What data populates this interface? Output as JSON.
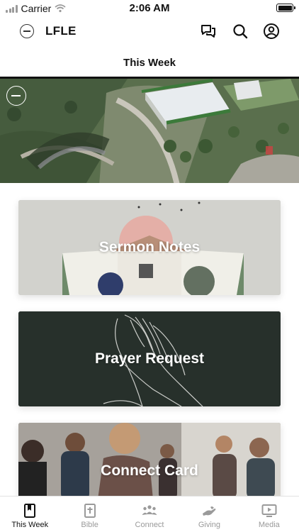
{
  "status_bar": {
    "carrier": "Carrier",
    "time": "2:06 AM"
  },
  "header": {
    "app_name": "LFLE"
  },
  "page_title": "This Week",
  "cards": {
    "sermon": {
      "label": "Sermon Notes"
    },
    "prayer": {
      "label": "Prayer Request"
    },
    "connect": {
      "label": "Connect Card"
    }
  },
  "tabs": [
    {
      "label": "This Week",
      "icon": "bookmark-book-icon",
      "active": true
    },
    {
      "label": "Bible",
      "icon": "bible-cross-icon",
      "active": false
    },
    {
      "label": "Connect",
      "icon": "people-group-icon",
      "active": false
    },
    {
      "label": "Giving",
      "icon": "giving-hand-icon",
      "active": false
    },
    {
      "label": "Media",
      "icon": "play-screen-icon",
      "active": false
    }
  ],
  "colors": {
    "active_tab": "#111111",
    "inactive_tab": "#9a9a9a",
    "prayer_card_bg": "#27302b"
  }
}
